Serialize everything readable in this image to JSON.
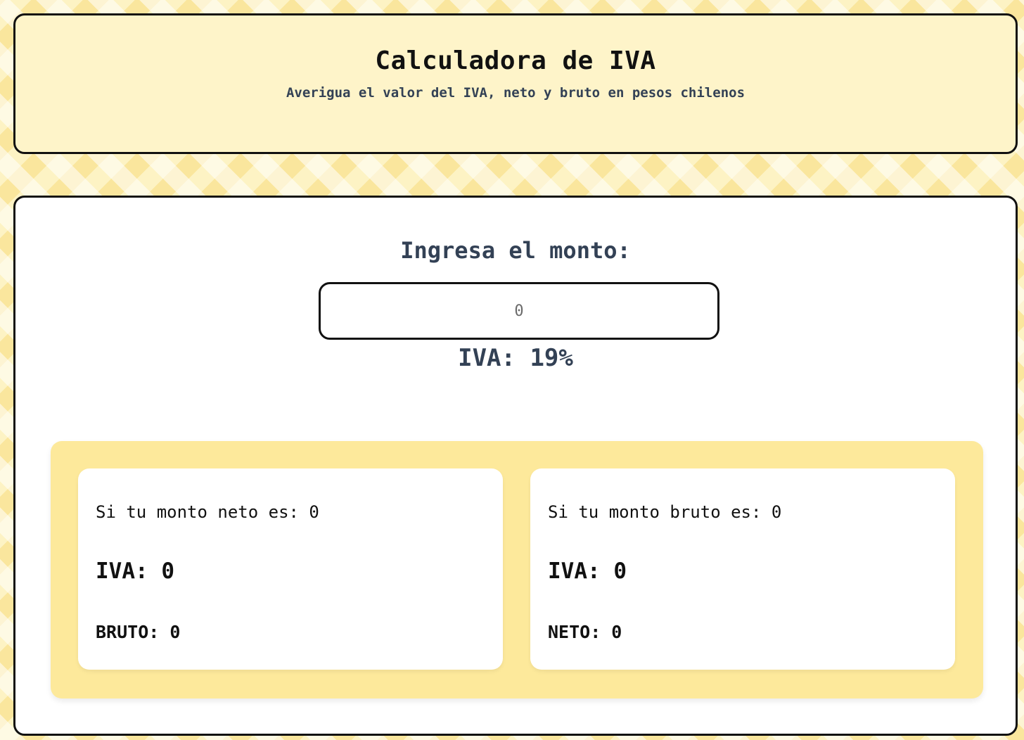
{
  "header": {
    "title": "Calculadora de IVA",
    "subtitle": "Averigua el valor del IVA, neto y bruto en pesos chilenos"
  },
  "main": {
    "amount_label": "Ingresa el monto:",
    "amount_input": {
      "value": "",
      "placeholder": "0"
    },
    "iva_rate": "IVA: 19%"
  },
  "results": {
    "neto_case": {
      "line1": "Si tu monto neto es: 0",
      "line2": "IVA: 0",
      "line3": "BRUTO: 0"
    },
    "bruto_case": {
      "line1": "Si tu monto bruto es: 0",
      "line2": "IVA: 0",
      "line3": "NETO: 0"
    }
  },
  "colors": {
    "header_bg": "#fef4c9",
    "panel_bg": "#fde99b",
    "border": "#111111",
    "text_secondary": "#334155"
  }
}
